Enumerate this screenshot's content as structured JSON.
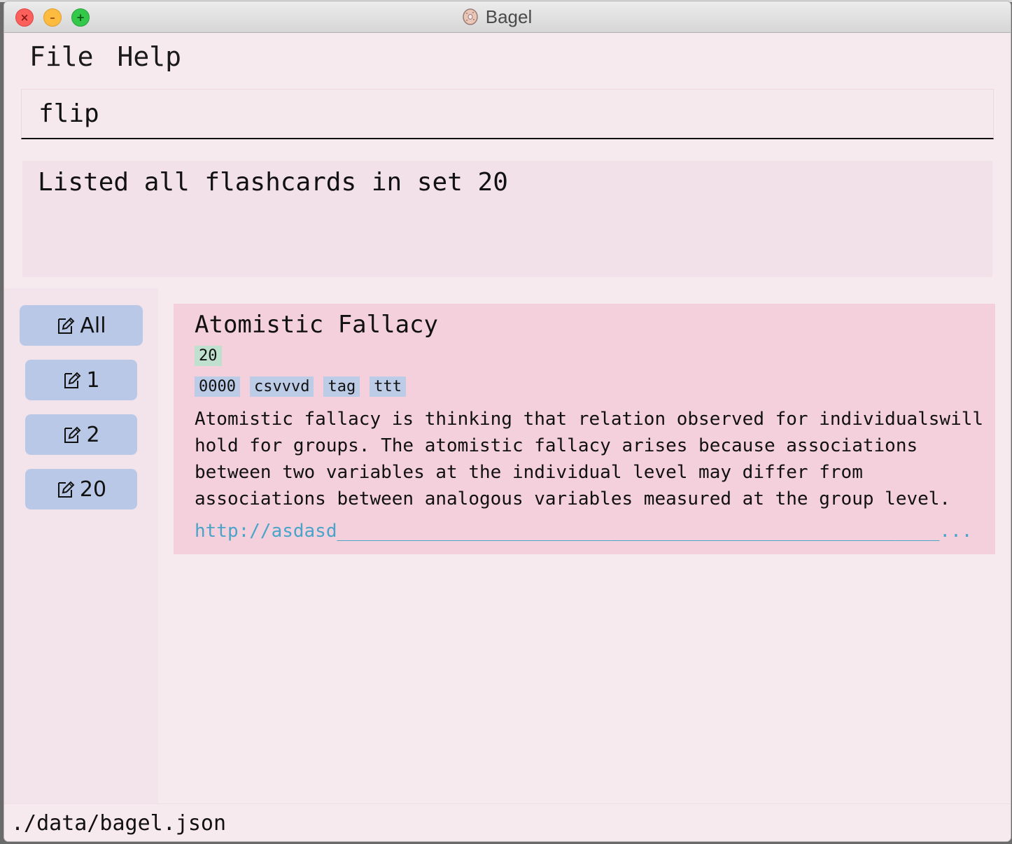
{
  "window": {
    "title": "Bagel",
    "close_glyph": "×",
    "minimize_glyph": "–",
    "maximize_glyph": "+"
  },
  "menu": {
    "items": [
      {
        "label": "File"
      },
      {
        "label": "Help"
      }
    ]
  },
  "command": {
    "value": "flip"
  },
  "result": {
    "message": "Listed all flashcards in set 20"
  },
  "sidebar": {
    "sets": [
      {
        "label": "All",
        "icon": "edit-icon",
        "selected": true
      },
      {
        "label": "1",
        "icon": "edit-icon",
        "selected": false
      },
      {
        "label": "2",
        "icon": "edit-icon",
        "selected": false
      },
      {
        "label": "20",
        "icon": "edit-icon",
        "selected": false
      }
    ]
  },
  "card": {
    "title": "Atomistic Fallacy",
    "set": "20",
    "tags": [
      "0000",
      "csvvvd",
      "tag",
      "ttt"
    ],
    "description": "Atomistic fallacy is thinking that relation observed for individualswill\nhold for groups. The atomistic fallacy arises because associations\nbetween two variables at the individual level may differ from\nassociations between analogous variables measured at the group level.",
    "link": "http://asdasd_______________________________________________________..."
  },
  "status": {
    "path": "./data/bagel.json"
  },
  "colors": {
    "window_bg": "#f7eaef",
    "card_bg": "#f4d0dc",
    "set_button": "#b9c8e6",
    "set_badge": "#bfe0cf",
    "tag": "#bccbe6",
    "link": "#4aa3c9"
  }
}
